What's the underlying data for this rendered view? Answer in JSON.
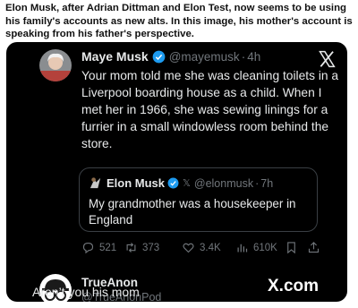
{
  "caption": "Elon Musk, after Adrian Dittman and Elon Test, now seems to be using his family's accounts as new alts. In this image, his mother's account is speaking from his father's perspective.",
  "tweet": {
    "author_name": "Maye Musk",
    "author_handle": "@mayemusk",
    "time": "4h",
    "text": "Your mom told me she was cleaning toilets in a Liverpool boarding house as a child. When I met her in 1966, she was sewing linings for a furrier in a small windowless room behind the store.",
    "icons": {
      "avatar": "portrait-avatar",
      "badge": "verified-badge-icon",
      "platform": "x-logo-icon"
    }
  },
  "quote": {
    "author_name": "Elon Musk",
    "x_glyph": "𝕏",
    "author_handle": "@elonmusk",
    "time": "7h",
    "text": "My grandmother was a housekeeper in England"
  },
  "actions": {
    "replies": "521",
    "reposts": "373",
    "likes": "3.4K",
    "views": "610K",
    "icons": [
      "reply-icon",
      "repost-icon",
      "like-icon",
      "views-icon",
      "bookmark-icon",
      "share-icon"
    ]
  },
  "reply": {
    "author_name": "TrueAnon",
    "author_handle": "@TrueAnonPod",
    "brand": "X.com",
    "text": "Aren’t you his mom"
  },
  "colors": {
    "card_bg": "#000000",
    "verified": "#1d9bf0",
    "muted": "#71767b",
    "text": "#e7e9ea"
  }
}
